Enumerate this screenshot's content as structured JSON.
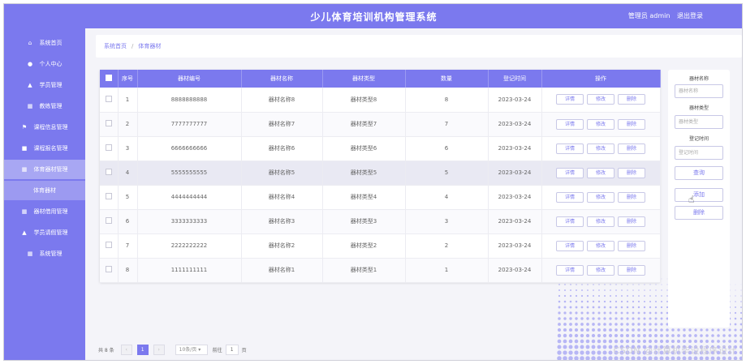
{
  "header": {
    "title": "少儿体育培训机构管理系统",
    "admin_text": "管理员 admin",
    "logout": "退出登录"
  },
  "sidebar": {
    "items": [
      {
        "label": "系统首页",
        "icon": "home-icon"
      },
      {
        "label": "个人中心",
        "icon": "user-icon"
      },
      {
        "label": "学员管理",
        "icon": "person-icon"
      },
      {
        "label": "教练管理",
        "icon": "grid-icon"
      },
      {
        "label": "课程信息管理",
        "icon": "flag-icon"
      },
      {
        "label": "课程报名管理",
        "icon": "doc-icon"
      },
      {
        "label": "体育器材管理",
        "icon": "grid-icon"
      },
      {
        "label": "体育器材",
        "icon": ""
      },
      {
        "label": "器材借用管理",
        "icon": "grid-icon"
      },
      {
        "label": "学员请假管理",
        "icon": "person-icon"
      },
      {
        "label": "系统管理",
        "icon": "grid-icon"
      }
    ]
  },
  "breadcrumb": {
    "home": "系统首页",
    "current": "体育器材"
  },
  "table": {
    "headers": [
      "序号",
      "器材编号",
      "器材名称",
      "器材类型",
      "数量",
      "登记时间",
      "操作"
    ],
    "rows": [
      {
        "index": "1",
        "code": "8888888888",
        "name": "器材名称8",
        "type": "器材类型8",
        "qty": "8",
        "date": "2023-03-24"
      },
      {
        "index": "2",
        "code": "7777777777",
        "name": "器材名称7",
        "type": "器材类型7",
        "qty": "7",
        "date": "2023-03-24"
      },
      {
        "index": "3",
        "code": "6666666666",
        "name": "器材名称6",
        "type": "器材类型6",
        "qty": "6",
        "date": "2023-03-24"
      },
      {
        "index": "4",
        "code": "5555555555",
        "name": "器材名称5",
        "type": "器材类型5",
        "qty": "5",
        "date": "2023-03-24"
      },
      {
        "index": "5",
        "code": "4444444444",
        "name": "器材名称4",
        "type": "器材类型4",
        "qty": "4",
        "date": "2023-03-24"
      },
      {
        "index": "6",
        "code": "3333333333",
        "name": "器材名称3",
        "type": "器材类型3",
        "qty": "3",
        "date": "2023-03-24"
      },
      {
        "index": "7",
        "code": "2222222222",
        "name": "器材名称2",
        "type": "器材类型2",
        "qty": "2",
        "date": "2023-03-24"
      },
      {
        "index": "8",
        "code": "1111111111",
        "name": "器材名称1",
        "type": "器材类型1",
        "qty": "1",
        "date": "2023-03-24"
      }
    ],
    "ops": {
      "detail": "详情",
      "edit": "修改",
      "delete": "删除"
    }
  },
  "search": {
    "name_label": "器材名称",
    "name_placeholder": "器材名称",
    "type_label": "器材类型",
    "type_placeholder": "器材类型",
    "time_label": "登记时间",
    "time_placeholder": "登记时间",
    "query_button": "查询",
    "add_button": "添加",
    "delete_button": "删除"
  },
  "pager": {
    "total": "共 8 条",
    "page": "1",
    "page_size": "10条/页",
    "goto": "前往",
    "goto_value": "1",
    "unit": "页"
  },
  "watermark": "CSDN @计算机毕设程序设计",
  "colors": {
    "accent": "#7b79ee",
    "accent_light": "#a8a7f3"
  }
}
